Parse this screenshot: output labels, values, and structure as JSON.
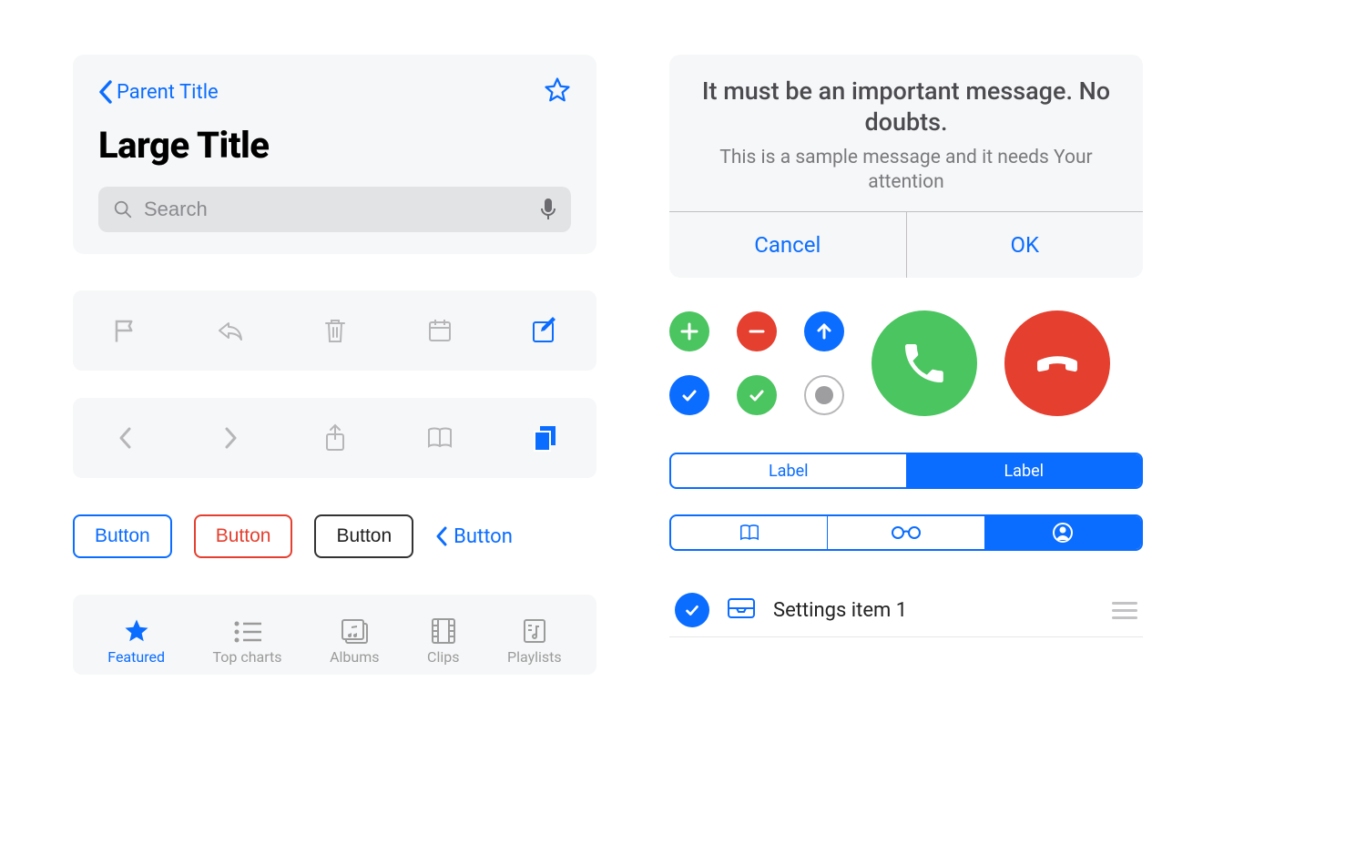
{
  "colors": {
    "blue": "#0b6dff",
    "red": "#e43f2f",
    "green": "#4bc560",
    "gray_bg": "#f6f7f8",
    "gray_icon": "#b6b6b8",
    "gray_text": "#7a7a7e"
  },
  "left": {
    "back_label": "Parent Title",
    "large_title": "Large Title",
    "search_placeholder": "Search",
    "buttons": {
      "blue": "Button",
      "red": "Button",
      "black": "Button",
      "text": "Button"
    },
    "tabbar": [
      {
        "label": "Featured",
        "icon": "star",
        "active": true
      },
      {
        "label": "Top charts",
        "icon": "list",
        "active": false
      },
      {
        "label": "Albums",
        "icon": "album",
        "active": false
      },
      {
        "label": "Clips",
        "icon": "film",
        "active": false
      },
      {
        "label": "Playlists",
        "icon": "playlist",
        "active": false
      }
    ]
  },
  "right": {
    "alert": {
      "title": "It must be an important message. No doubts.",
      "message": "This is a sample message and it needs Your attention",
      "cancel": "Cancel",
      "ok": "OK"
    },
    "segmented1": {
      "a": "Label",
      "b": "Label"
    },
    "settings_item": "Settings item 1"
  }
}
